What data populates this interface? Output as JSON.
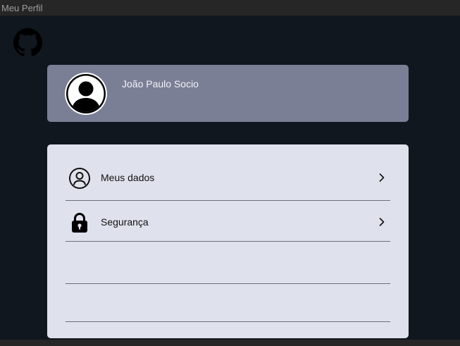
{
  "window": {
    "title": "Meu Perfil"
  },
  "header": {
    "logo_icon": "github-icon"
  },
  "profile": {
    "name": "João Paulo Socio",
    "avatar_icon": "user-avatar-icon"
  },
  "menu": {
    "items": [
      {
        "label": "Meus dados",
        "icon": "user-circle-icon",
        "chevron_icon": "chevron-right-icon"
      },
      {
        "label": "Segurança",
        "icon": "lock-icon",
        "chevron_icon": "chevron-right-icon"
      }
    ]
  },
  "colors": {
    "window_chrome": "#262626",
    "app_background": "#11171f",
    "profile_card": "#7b7f96",
    "menu_card": "#dfe2ec",
    "divider": "#6a6e78"
  }
}
